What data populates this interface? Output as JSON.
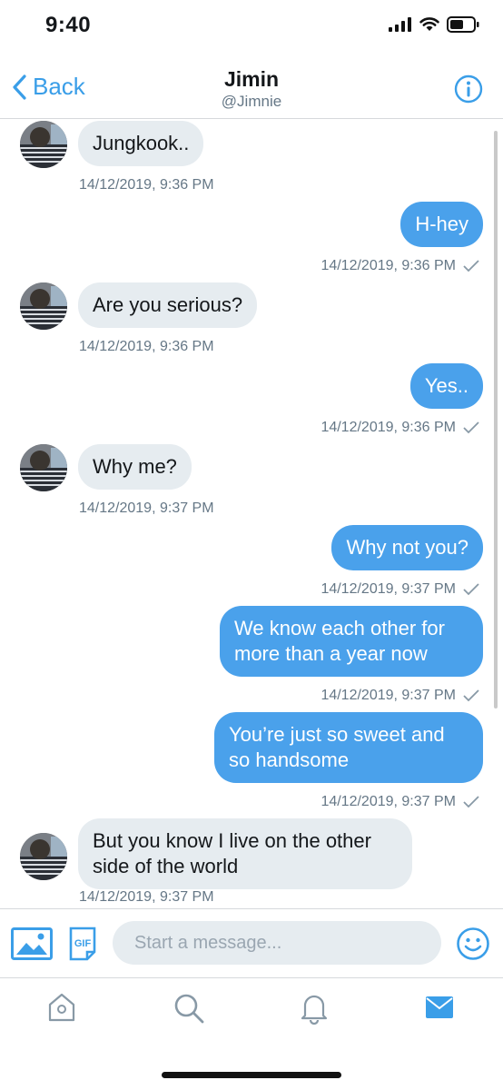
{
  "status": {
    "time": "9:40"
  },
  "header": {
    "back_label": "Back",
    "name": "Jimin",
    "handle": "@Jimnie"
  },
  "messages": [
    {
      "from": "them",
      "text": "Jungkook..",
      "time": "14/12/2019, 9:36 PM"
    },
    {
      "from": "me",
      "text": "H-hey",
      "time": "14/12/2019, 9:36 PM"
    },
    {
      "from": "them",
      "text": "Are you serious?",
      "time": "14/12/2019, 9:36 PM"
    },
    {
      "from": "me",
      "text": "Yes..",
      "time": "14/12/2019, 9:36 PM"
    },
    {
      "from": "them",
      "text": "Why me?",
      "time": "14/12/2019, 9:37 PM"
    },
    {
      "from": "me",
      "text": "Why not you?",
      "time": "14/12/2019, 9:37 PM"
    },
    {
      "from": "me",
      "text": "We know each other for more than a year now",
      "time": "14/12/2019, 9:37 PM"
    },
    {
      "from": "me",
      "text": "You’re just so sweet and so handsome",
      "time": "14/12/2019, 9:37 PM"
    },
    {
      "from": "them",
      "text": "But you know I live on the other side of the world",
      "time": "14/12/2019, 9:37 PM"
    }
  ],
  "composer": {
    "placeholder": "Start a message...",
    "gif_label": "GIF"
  },
  "tabs": [
    {
      "name": "home-icon"
    },
    {
      "name": "search-icon"
    },
    {
      "name": "bell-icon"
    },
    {
      "name": "mail-icon"
    }
  ],
  "colors": {
    "accent": "#4aa1eb",
    "incoming_bubble": "#e6ecf0",
    "muted": "#657786"
  }
}
